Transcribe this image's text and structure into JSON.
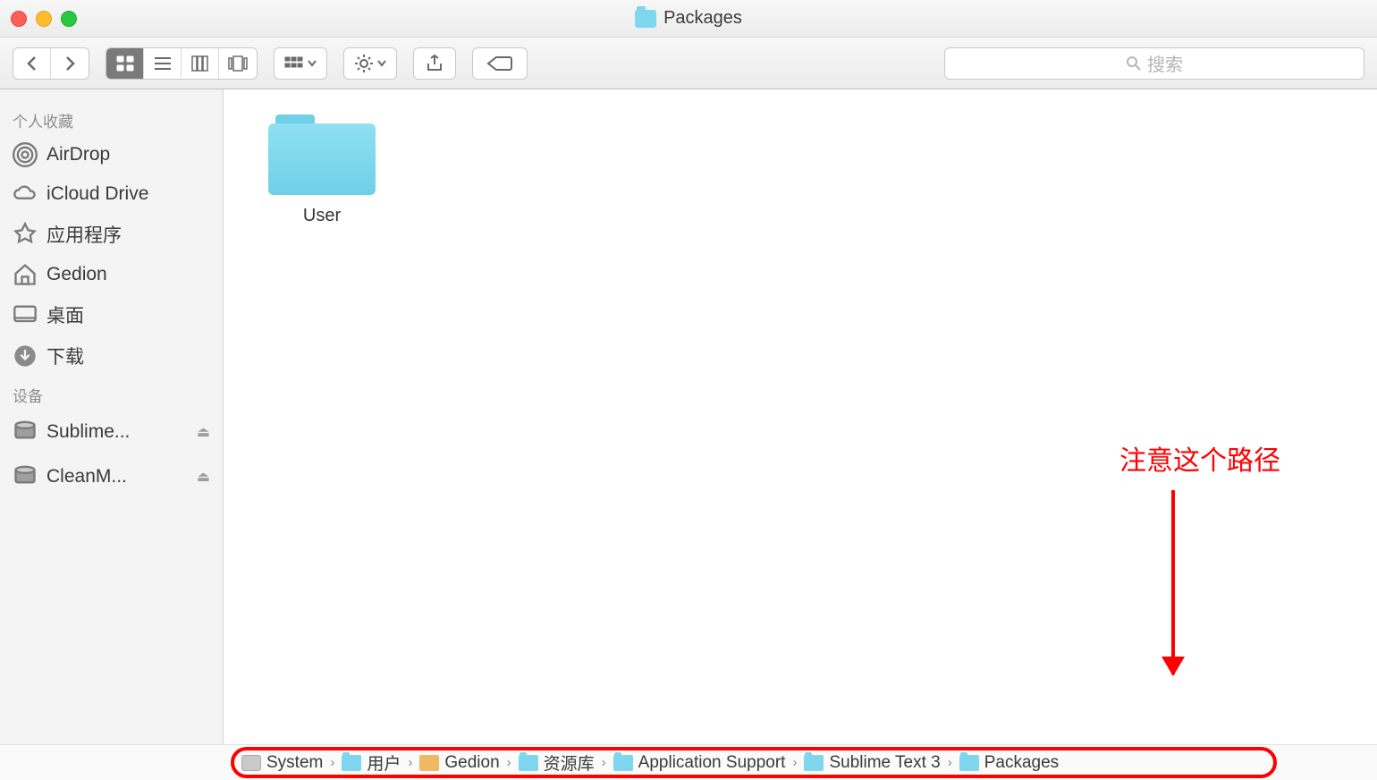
{
  "window": {
    "title": "Packages"
  },
  "search": {
    "placeholder": "搜索"
  },
  "sidebar": {
    "favorites_header": "个人收藏",
    "devices_header": "设备",
    "favorites": [
      {
        "label": "AirDrop",
        "icon": "airdrop"
      },
      {
        "label": "iCloud Drive",
        "icon": "cloud"
      },
      {
        "label": "应用程序",
        "icon": "apps"
      },
      {
        "label": "Gedion",
        "icon": "home"
      },
      {
        "label": "桌面",
        "icon": "desktop"
      },
      {
        "label": "下载",
        "icon": "download"
      }
    ],
    "devices": [
      {
        "label": "Sublime...",
        "ejectable": true
      },
      {
        "label": "CleanM...",
        "ejectable": true
      }
    ]
  },
  "content": {
    "items": [
      {
        "name": "User",
        "type": "folder"
      }
    ]
  },
  "annotation": {
    "text": "注意这个路径"
  },
  "pathbar": {
    "crumbs": [
      {
        "label": "System",
        "icon": "disk"
      },
      {
        "label": "用户",
        "icon": "folder"
      },
      {
        "label": "Gedion",
        "icon": "home"
      },
      {
        "label": "资源库",
        "icon": "folder"
      },
      {
        "label": "Application Support",
        "icon": "folder"
      },
      {
        "label": "Sublime Text 3",
        "icon": "folder"
      },
      {
        "label": "Packages",
        "icon": "folder"
      }
    ]
  }
}
